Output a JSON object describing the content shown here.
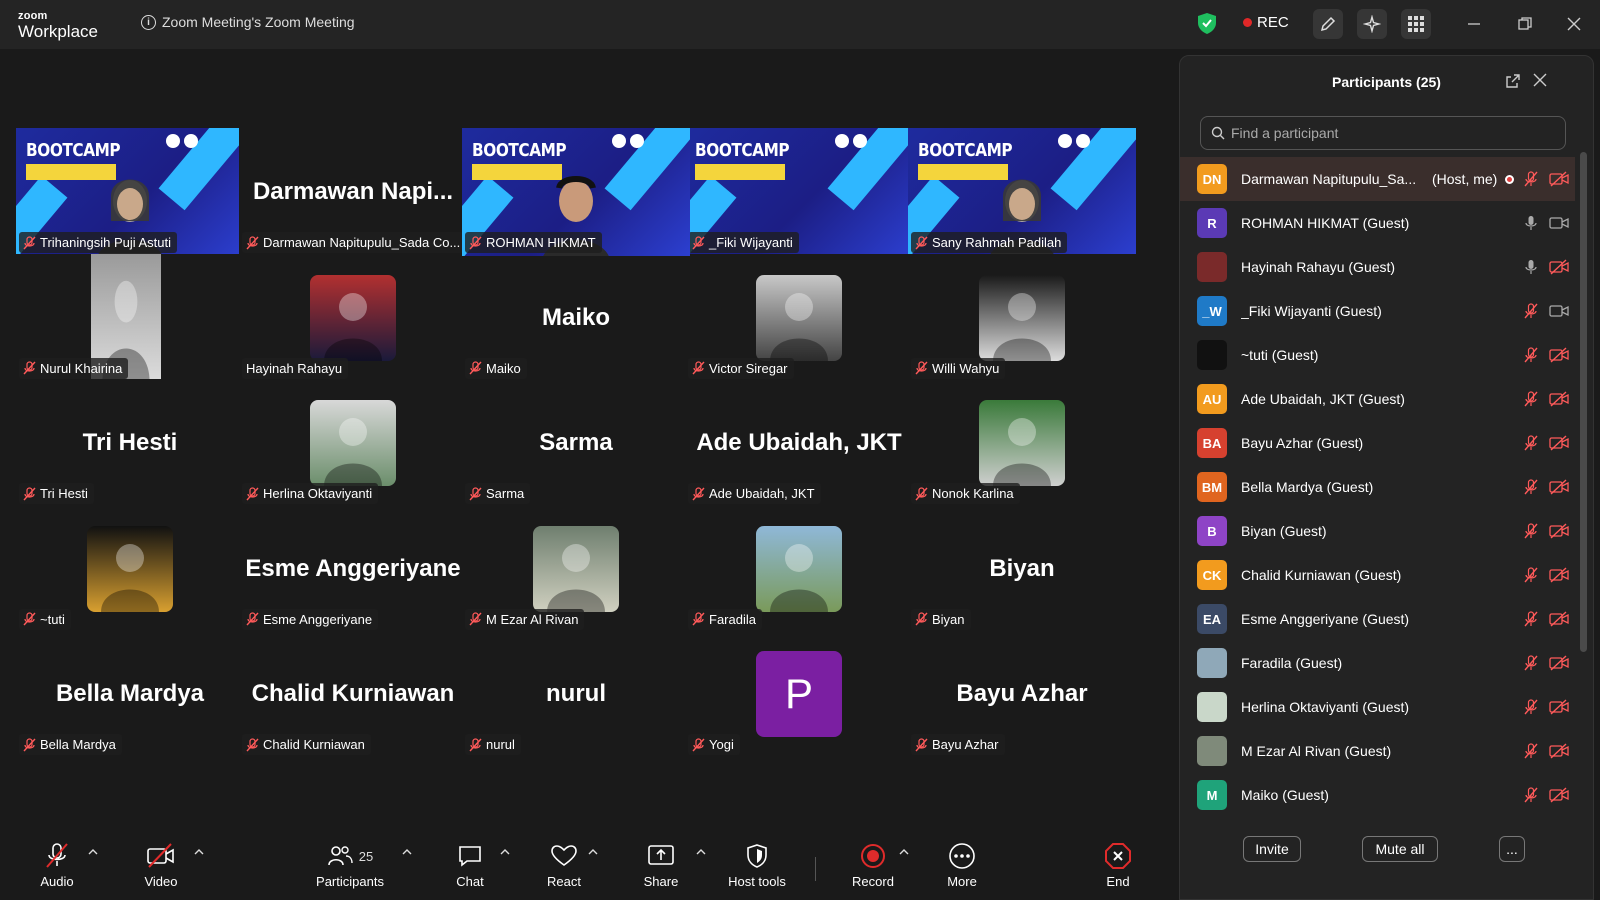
{
  "titlebar": {
    "brand_line1": "zoom",
    "brand_line2": "Workplace",
    "meeting_title": "Zoom Meeting's Zoom Meeting",
    "rec_label": "REC"
  },
  "grid": {
    "tiles": [
      {
        "name": "Trihaningsih Puji Astuti",
        "kind": "video"
      },
      {
        "name": "Darmawan Napitupulu_Sada Co...",
        "kind": "text",
        "big": "Darmawan  Napi..."
      },
      {
        "name": "ROHMAN HIKMAT",
        "kind": "video",
        "active": true
      },
      {
        "name": "_Fiki Wijayanti",
        "kind": "video"
      },
      {
        "name": "Sany Rahmah Padilah",
        "kind": "video"
      },
      {
        "name": "Nurul Khairina",
        "kind": "photo"
      },
      {
        "name": "Hayinah Rahayu",
        "kind": "photo"
      },
      {
        "name": "Maiko",
        "kind": "text",
        "big": "Maiko"
      },
      {
        "name": "Victor Siregar",
        "kind": "photo"
      },
      {
        "name": "Willi Wahyu",
        "kind": "photo"
      },
      {
        "name": "Tri Hesti",
        "kind": "text",
        "big": "Tri Hesti"
      },
      {
        "name": "Herlina Oktaviyanti",
        "kind": "photo"
      },
      {
        "name": "Sarma",
        "kind": "text",
        "big": "Sarma"
      },
      {
        "name": "Ade Ubaidah, JKT",
        "kind": "text",
        "big": "Ade Ubaidah, JKT"
      },
      {
        "name": "Nonok Karlina",
        "kind": "photo"
      },
      {
        "name": "~tuti",
        "kind": "photo"
      },
      {
        "name": "Esme Anggeriyane",
        "kind": "text",
        "big": "Esme Anggeriyane"
      },
      {
        "name": "M Ezar Al Rivan",
        "kind": "photo"
      },
      {
        "name": "Faradila",
        "kind": "photo"
      },
      {
        "name": "Biyan",
        "kind": "text",
        "big": "Biyan"
      },
      {
        "name": "Bella Mardya",
        "kind": "text",
        "big": "Bella Mardya"
      },
      {
        "name": "Chalid Kurniawan",
        "kind": "text",
        "big": "Chalid Kurniawan"
      },
      {
        "name": "nurul",
        "kind": "text",
        "big": "nurul"
      },
      {
        "name": "Yogi",
        "kind": "letter",
        "letter": "P"
      },
      {
        "name": "Bayu Azhar",
        "kind": "text",
        "big": "Bayu Azhar"
      }
    ],
    "bootcamp_text": "BOOTCAMP"
  },
  "toolbar": {
    "audio": "Audio",
    "video": "Video",
    "participants": "Participants",
    "participants_count": "25",
    "chat": "Chat",
    "react": "React",
    "share": "Share",
    "host_tools": "Host tools",
    "record": "Record",
    "more": "More",
    "end": "End"
  },
  "panel": {
    "title": "Participants (25)",
    "search_placeholder": "Find a participant",
    "invite": "Invite",
    "mute_all": "Mute all",
    "more": "...",
    "participants": [
      {
        "initials": "DN",
        "color": "#f29b1e",
        "name": "Darmawan Napitupulu_Sa...",
        "tag": "(Host, me)",
        "mic": "off",
        "cam": "off"
      },
      {
        "initials": "R",
        "color": "#5b3ab5",
        "name": "ROHMAN HIKMAT (Guest)",
        "mic": "on",
        "cam": "on"
      },
      {
        "initials": "",
        "color": "#7a2a2a",
        "name": "Hayinah Rahayu (Guest)",
        "mic": "on",
        "cam": "off"
      },
      {
        "initials": "_W",
        "color": "#1f7ac7",
        "name": "_Fiki Wijayanti (Guest)",
        "mic": "off",
        "cam": "on"
      },
      {
        "initials": "",
        "color": "#111111",
        "name": "~tuti (Guest)",
        "mic": "off",
        "cam": "off"
      },
      {
        "initials": "AU",
        "color": "#f29b1e",
        "name": "Ade Ubaidah, JKT (Guest)",
        "mic": "off",
        "cam": "off"
      },
      {
        "initials": "BA",
        "color": "#d6412f",
        "name": "Bayu Azhar (Guest)",
        "mic": "off",
        "cam": "off"
      },
      {
        "initials": "BM",
        "color": "#e0651f",
        "name": "Bella Mardya (Guest)",
        "mic": "off",
        "cam": "off"
      },
      {
        "initials": "B",
        "color": "#8e44c6",
        "name": "Biyan (Guest)",
        "mic": "off",
        "cam": "off"
      },
      {
        "initials": "CK",
        "color": "#f29b1e",
        "name": "Chalid Kurniawan (Guest)",
        "mic": "off",
        "cam": "off"
      },
      {
        "initials": "EA",
        "color": "#3b4a66",
        "name": "Esme Anggeriyane (Guest)",
        "mic": "off",
        "cam": "off"
      },
      {
        "initials": "",
        "color": "#8fa8b8",
        "name": "Faradila (Guest)",
        "mic": "off",
        "cam": "off"
      },
      {
        "initials": "",
        "color": "#c9d7c9",
        "name": "Herlina Oktaviyanti (Guest)",
        "mic": "off",
        "cam": "off"
      },
      {
        "initials": "",
        "color": "#7f8a7a",
        "name": "M Ezar Al Rivan (Guest)",
        "mic": "off",
        "cam": "off"
      },
      {
        "initials": "M",
        "color": "#1fa37a",
        "name": "Maiko (Guest)",
        "mic": "off",
        "cam": "off"
      }
    ]
  },
  "colors": {
    "accent_active": "#2ecc9a",
    "rec_red": "#e02828",
    "end_red": "#e02b2b",
    "shield_green": "#1fbf5f"
  }
}
